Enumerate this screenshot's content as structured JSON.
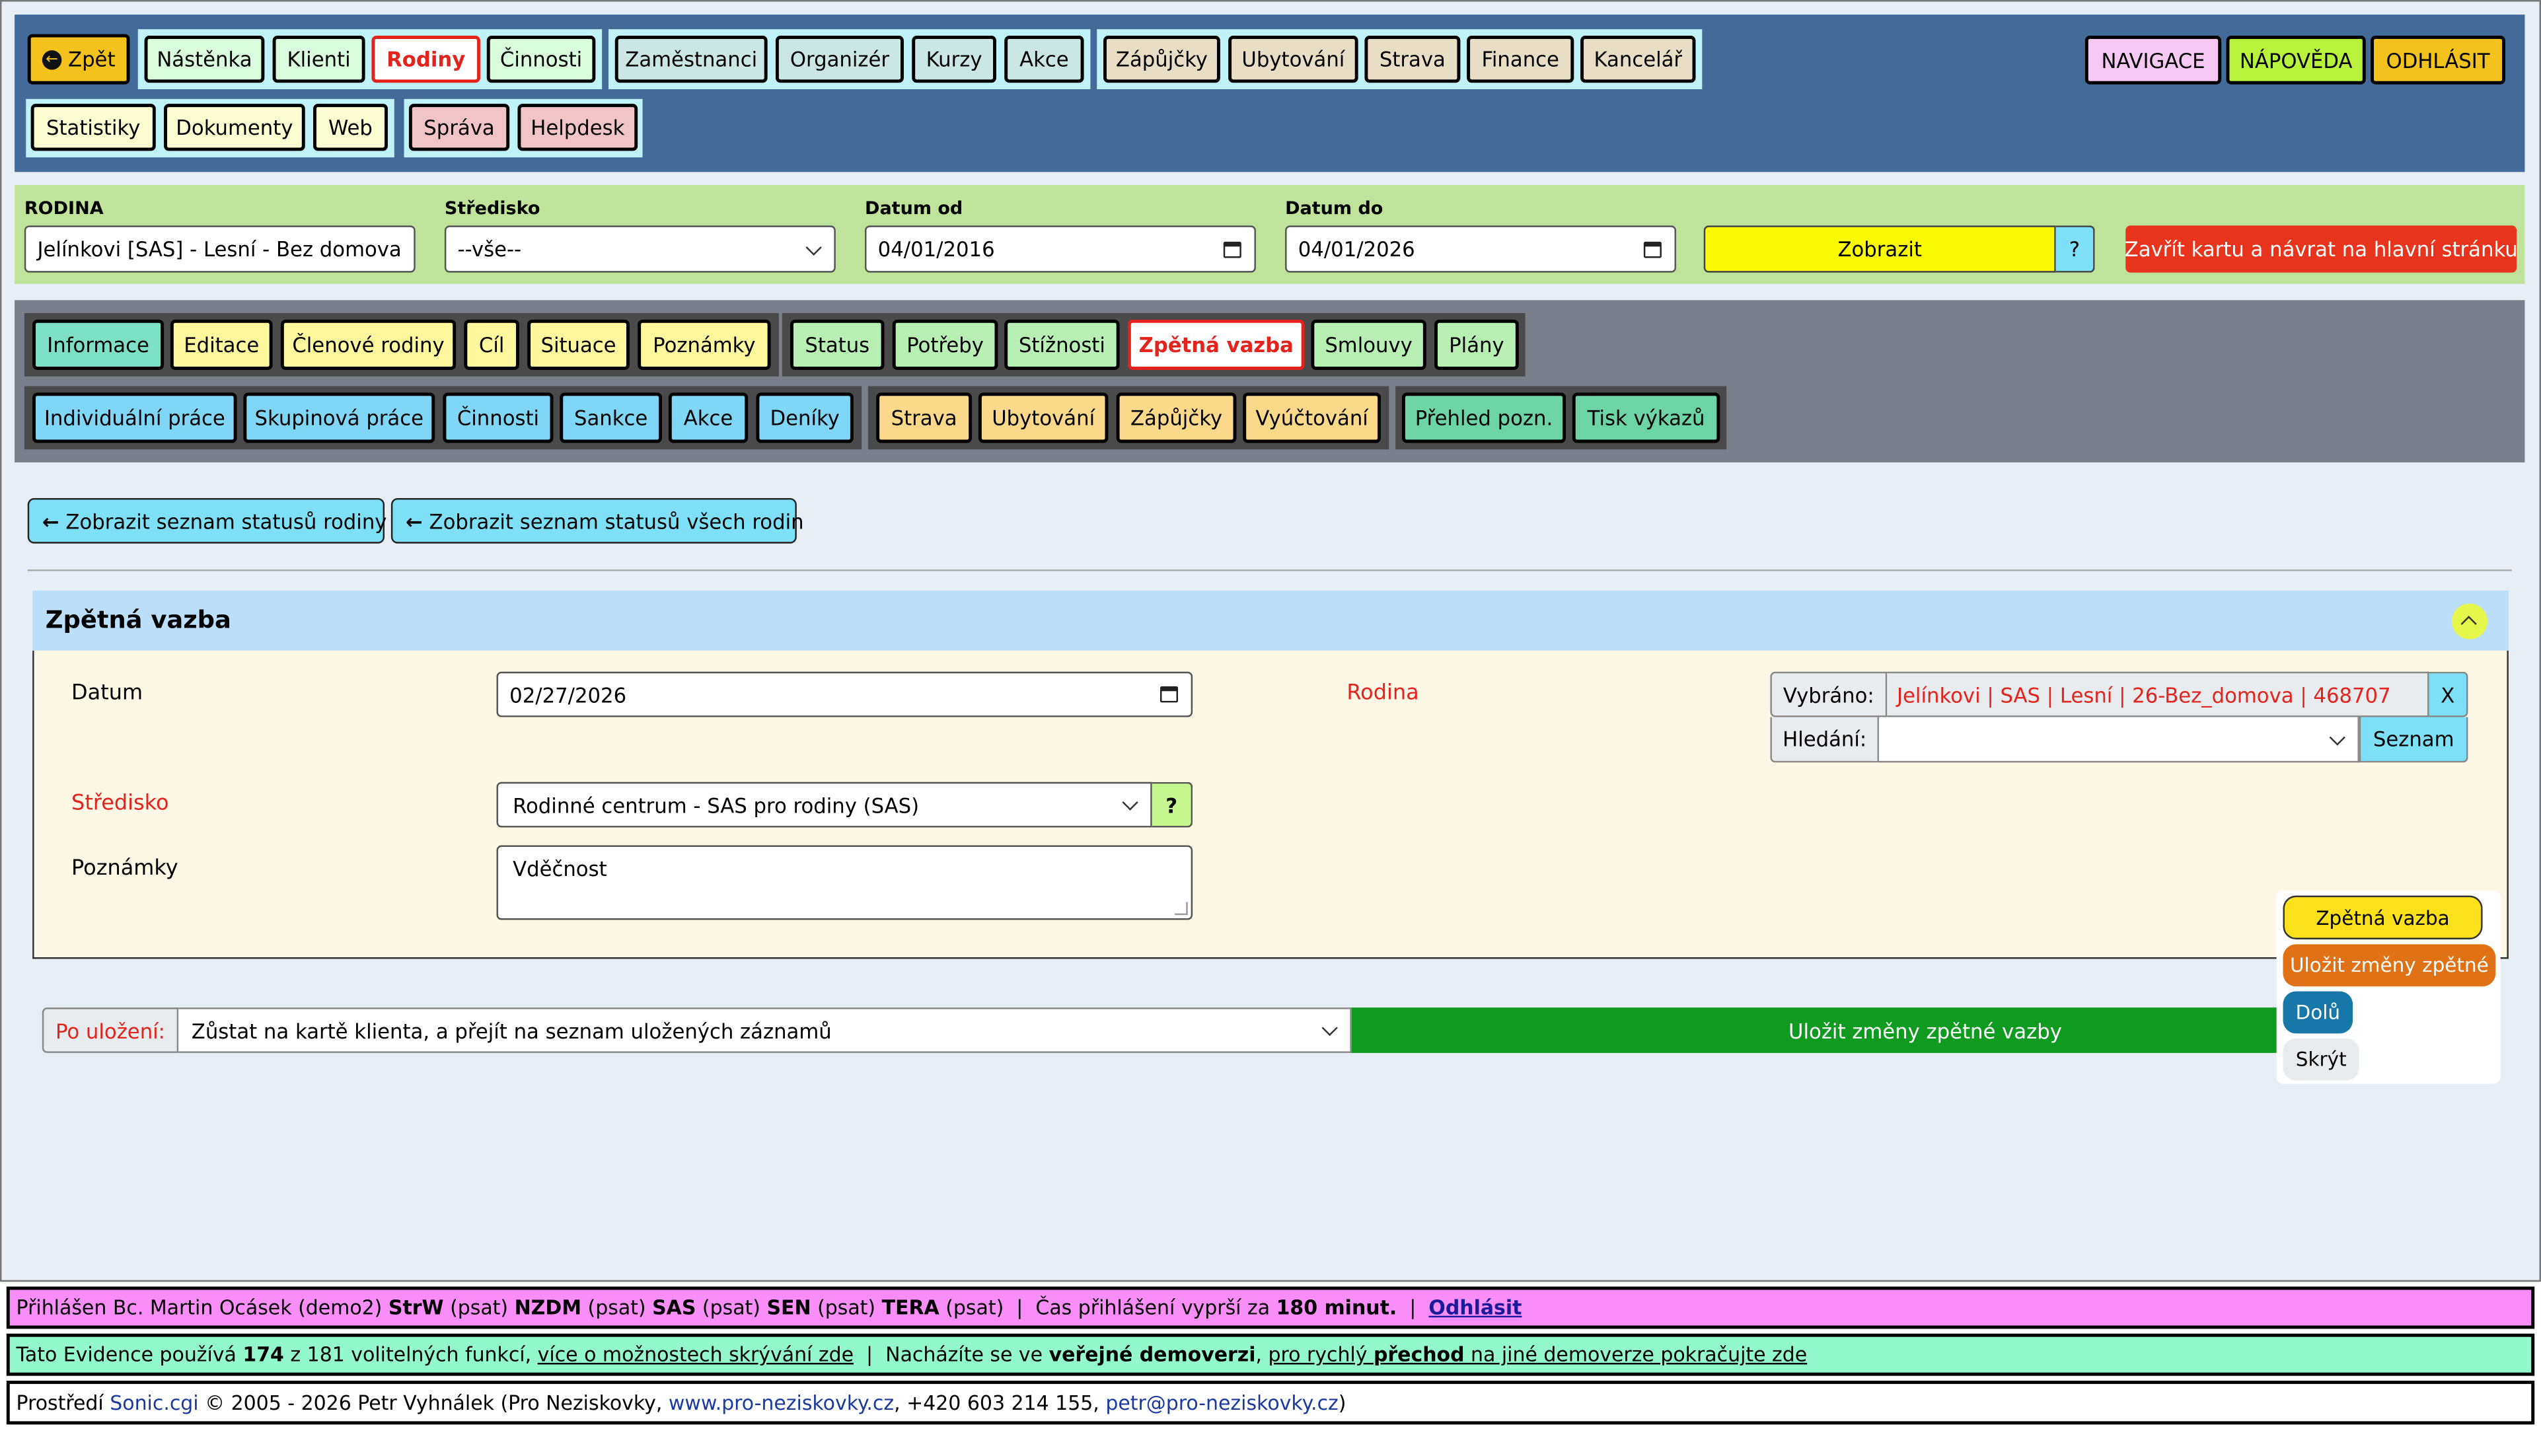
{
  "top_nav": {
    "back": "Zpět",
    "row1_green": [
      "Nástěnka",
      "Klienti",
      "Rodiny",
      "Činnosti"
    ],
    "row1_teal": [
      "Zaměstnanci",
      "Organizér",
      "Kurzy",
      "Akce"
    ],
    "row1_tan": [
      "Zápůjčky",
      "Ubytování",
      "Strava",
      "Finance",
      "Kancelář"
    ],
    "row2_yellow": [
      "Statistiky",
      "Dokumenty",
      "Web"
    ],
    "row2_pink": [
      "Správa",
      "Helpdesk"
    ],
    "right": {
      "navigace": "NAVIGACE",
      "napoveda": "NÁPOVĚDA",
      "odhlasit": "ODHLÁSIT"
    }
  },
  "filter": {
    "rodina_label": "RODINA",
    "rodina_value": "Jelínkovi [SAS] - Lesní - Bez domova",
    "stredisko_label": "Středisko",
    "stredisko_value": "--vše--",
    "datum_od_label": "Datum od",
    "datum_od_value": "04/01/2016",
    "datum_do_label": "Datum do",
    "datum_do_value": "04/01/2026",
    "zobrazit": "Zobrazit",
    "help": "?",
    "close": "Zavřít kartu a návrat na hlavní stránku"
  },
  "card_tabs": {
    "row1_a": [
      "Informace",
      "Editace",
      "Členové rodiny",
      "Cíl",
      "Situace",
      "Poznámky"
    ],
    "row1_b": [
      "Status",
      "Potřeby",
      "Stížnosti",
      "Zpětná vazba",
      "Smlouvy",
      "Plány"
    ],
    "row2_a": [
      "Individuální práce",
      "Skupinová práce",
      "Činnosti",
      "Sankce",
      "Akce",
      "Deníky"
    ],
    "row2_b": [
      "Strava",
      "Ubytování",
      "Zápůjčky",
      "Vyúčtování"
    ],
    "row2_c": [
      "Přehled pozn.",
      "Tisk výkazů"
    ]
  },
  "links": {
    "status_rodiny": "Zobrazit seznam statusů rodiny",
    "status_vsech": "Zobrazit seznam statusů všech rodin"
  },
  "panel": {
    "title": "Zpětná vazba",
    "datum_label": "Datum",
    "datum_value": "02/27/2026",
    "rodina_label": "Rodina",
    "vybrano_label": "Vybráno:",
    "vybrano_value": "Jelínkovi | SAS | Lesní | 26-Bez_domova | 468707",
    "vybrano_clear": "X",
    "hledani_label": "Hledání:",
    "hledani_value": "",
    "seznam": "Seznam",
    "stredisko_label": "Středisko",
    "stredisko_value": "Rodinné centrum - SAS pro rodiny (SAS)",
    "stredisko_help": "?",
    "poznamky_label": "Poznámky",
    "poznamky_value": "Vděčnost"
  },
  "save_bar": {
    "po_ulozeni_label": "Po uložení:",
    "po_ulozeni_value": "Zůstat na kartě klienta, a přejít na seznam uložených záznamů",
    "save": "Uložit změny zpětné vazby"
  },
  "floating": {
    "zpetna_vazba": "Zpětná vazba",
    "ulozit": "Uložit změny zpětné",
    "dolu": "Dolů",
    "skryt": "Skrýt"
  },
  "footer": {
    "line1": {
      "prefix": "Přihlášen Bc. Martin Ocásek (demo2)",
      "r1": "StrW",
      "r1p": "(psat)",
      "r2": "NZDM",
      "r2p": "(psat)",
      "r3": "SAS",
      "r3p": "(psat)",
      "r4": "SEN",
      "r4p": "(psat)",
      "r5": "TERA",
      "r5p": "(psat)",
      "sep1": "|",
      "expire_text": "Čas přihlášení vyprší za",
      "expire_value": "180 minut.",
      "sep2": "|",
      "logout": "Odhlásit"
    },
    "line2": {
      "t1": "Tato Evidence používá",
      "count": "174",
      "t2": "z 181 volitelných funkcí,",
      "link1": "více o možnostech skrývání zde",
      "sep": "|",
      "t3": "Nacházíte se ve",
      "bold1": "veřejné demoverzi",
      "t4": ",",
      "link2a": "pro rychlý",
      "link2b": "přechod",
      "link2c": "na jiné demoverze pokračujte zde"
    },
    "line3": {
      "t1": "Prostředí",
      "sonic": "Sonic.cgi",
      "t2": "© 2005 - 2026 Petr Vyhnálek (Pro Neziskovky,",
      "web": "www.pro-neziskovky.cz",
      "t3": ", +420 603 214 155,",
      "mail": "petr@pro-neziskovky.cz",
      "t4": ")"
    }
  },
  "colors": {
    "header_bg": "#426b9a",
    "filter_bg": "#bfe39b",
    "tabs_bg": "#7a7f8c",
    "content_bg": "#e8eef5",
    "panel_header": "#bbdefb",
    "panel_body": "#fdf8e6",
    "save_green": "#0f9a20",
    "close_red": "#e8341c"
  }
}
